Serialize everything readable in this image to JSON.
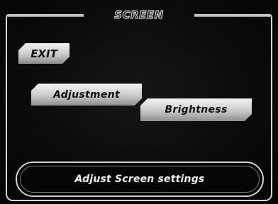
{
  "menu": {
    "title": "SCREEN",
    "buttons": {
      "exit": "EXIT",
      "adjustment": "Adjustment",
      "brightness": "Brightness"
    }
  },
  "status": {
    "help_text": "Adjust Screen settings"
  },
  "colors": {
    "background": "#0a0a0a",
    "frame": "#d6d6d6",
    "button_face": "#c9c9c9",
    "text_light": "#f2f2f2"
  }
}
